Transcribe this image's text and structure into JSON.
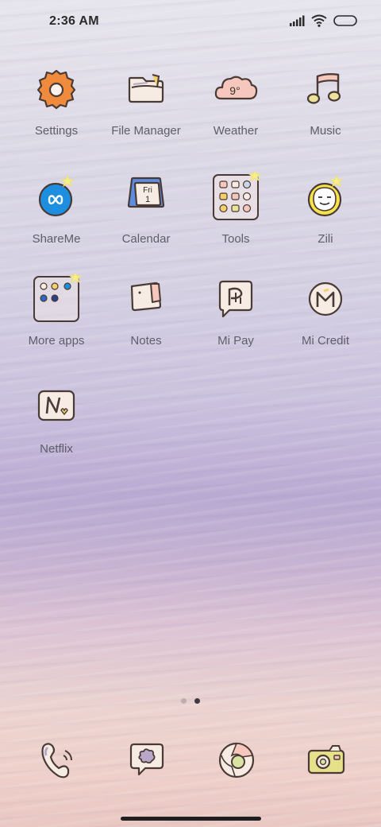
{
  "status_bar": {
    "time": "2:36 AM",
    "icons": [
      "signal-icon",
      "wifi-icon",
      "battery-icon"
    ]
  },
  "apps": [
    {
      "label": "Settings",
      "icon": "gear-icon"
    },
    {
      "label": "File Manager",
      "icon": "folder-icon"
    },
    {
      "label": "Weather",
      "icon": "cloud-icon",
      "temperature": "9°"
    },
    {
      "label": "Music",
      "icon": "music-note-icon"
    },
    {
      "label": "ShareMe",
      "icon": "infinity-icon"
    },
    {
      "label": "Calendar",
      "icon": "calendar-icon",
      "day": "Fri",
      "date": "1"
    },
    {
      "label": "Tools",
      "icon": "folder-grid-icon"
    },
    {
      "label": "Zili",
      "icon": "smiley-face-icon"
    },
    {
      "label": "More apps",
      "icon": "folder-grid-icon"
    },
    {
      "label": "Notes",
      "icon": "note-icon"
    },
    {
      "label": "Mi Pay",
      "icon": "pay-icon"
    },
    {
      "label": "Mi Credit",
      "icon": "credit-icon"
    },
    {
      "label": "Netflix",
      "icon": "netflix-icon"
    }
  ],
  "page_indicator": {
    "pages": 2,
    "current": 2
  },
  "dock": [
    {
      "icon": "phone-icon"
    },
    {
      "icon": "message-icon"
    },
    {
      "icon": "browser-icon"
    },
    {
      "icon": "camera-icon"
    }
  ],
  "colors": {
    "outline": "#4a3a36",
    "settings_orange": "#f08a3c",
    "shareme_blue": "#1e8fe0",
    "zili_yellow": "#f7e44a",
    "cream": "#f6ece4",
    "label": "#5e5d68"
  }
}
